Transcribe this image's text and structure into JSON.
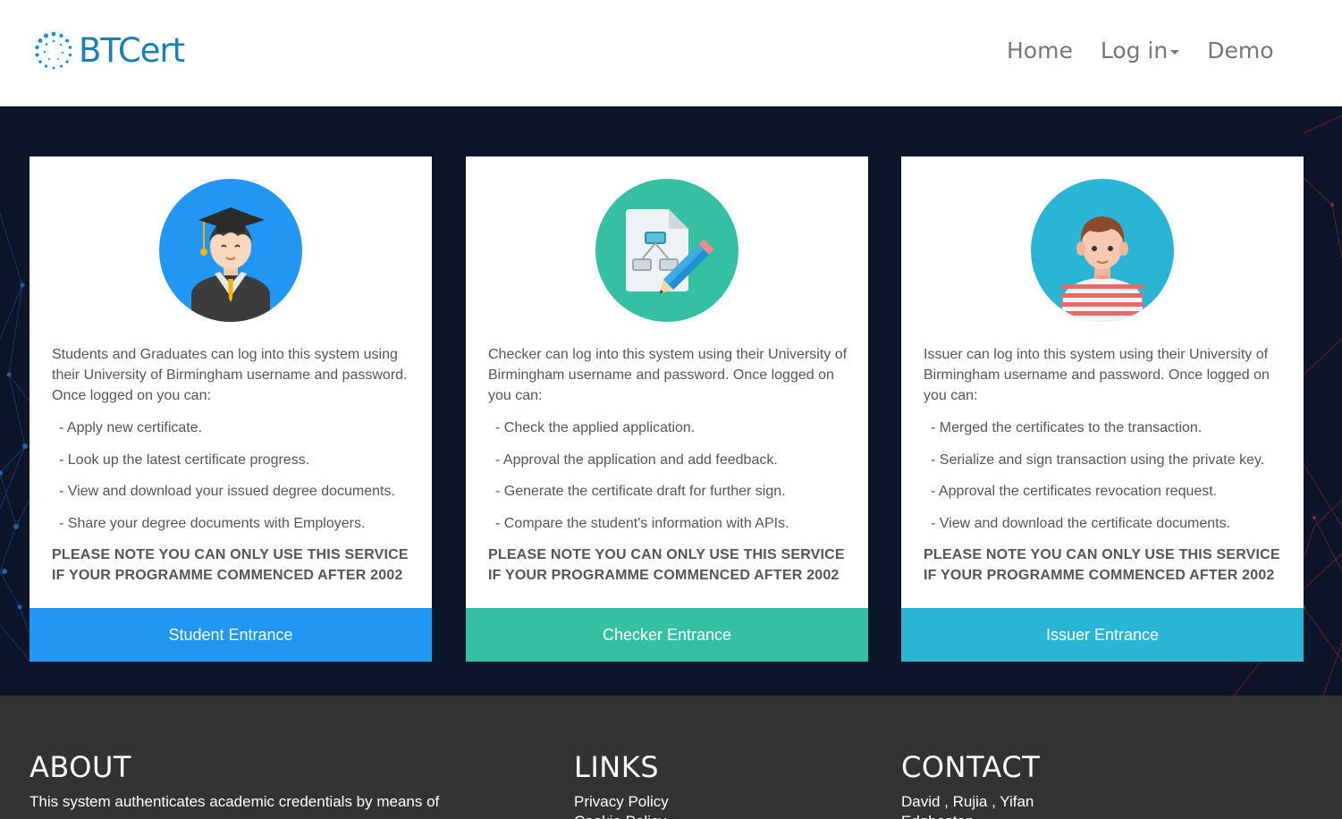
{
  "brand": {
    "name": "BTCert",
    "logo": "dotted-ring-logo",
    "color": "#1a7fb8"
  },
  "nav": {
    "home": "Home",
    "login": "Log in",
    "demo": "Demo"
  },
  "cards": [
    {
      "icon": "graduate-icon",
      "color": "#2196f3",
      "description": "Students and Graduates can log into this system using their University of Birmingham username and password. Once logged on you can:",
      "items": [
        "- Apply new certificate.",
        "- Look up the latest certificate progress.",
        "- View and download your issued degree documents.",
        "- Share your degree documents with Employers."
      ],
      "note": "PLEASE NOTE YOU CAN ONLY USE THIS SERVICE IF YOUR PROGRAMME COMMENCED AFTER 2002",
      "button": "Student Entrance"
    },
    {
      "icon": "document-edit-icon",
      "color": "#35bfa3",
      "description": "Checker can log into this system using their University of Birmingham username and password. Once logged on you can:",
      "items": [
        "- Check the applied application.",
        "- Approval the application and add feedback.",
        "- Generate the certificate draft for further sign.",
        "- Compare the student's information with APIs."
      ],
      "note": "PLEASE NOTE YOU CAN ONLY USE THIS SERVICE IF YOUR PROGRAMME COMMENCED AFTER 2002",
      "button": "Checker Entrance"
    },
    {
      "icon": "person-icon",
      "color": "#2bb5d4",
      "description": "Issuer can log into this system using their University of Birmingham username and password. Once logged on you can:",
      "items": [
        "- Merged the certificates to the transaction.",
        "- Serialize and sign transaction using the private key.",
        "- Approval the certificates revocation request.",
        "- View and download the certificate documents."
      ],
      "note": "PLEASE NOTE YOU CAN ONLY USE THIS SERVICE IF YOUR PROGRAMME COMMENCED AFTER 2002",
      "button": "Issuer Entrance"
    }
  ],
  "footer": {
    "about": {
      "title": "ABOUT",
      "text": "This system authenticates academic credentials by means of"
    },
    "links": {
      "title": "LINKS",
      "items": [
        "Privacy Policy",
        "Cookie Policy"
      ]
    },
    "contact": {
      "title": "CONTACT",
      "names": "David , Rujia , Yifan",
      "extra": "Edgbaston"
    }
  }
}
